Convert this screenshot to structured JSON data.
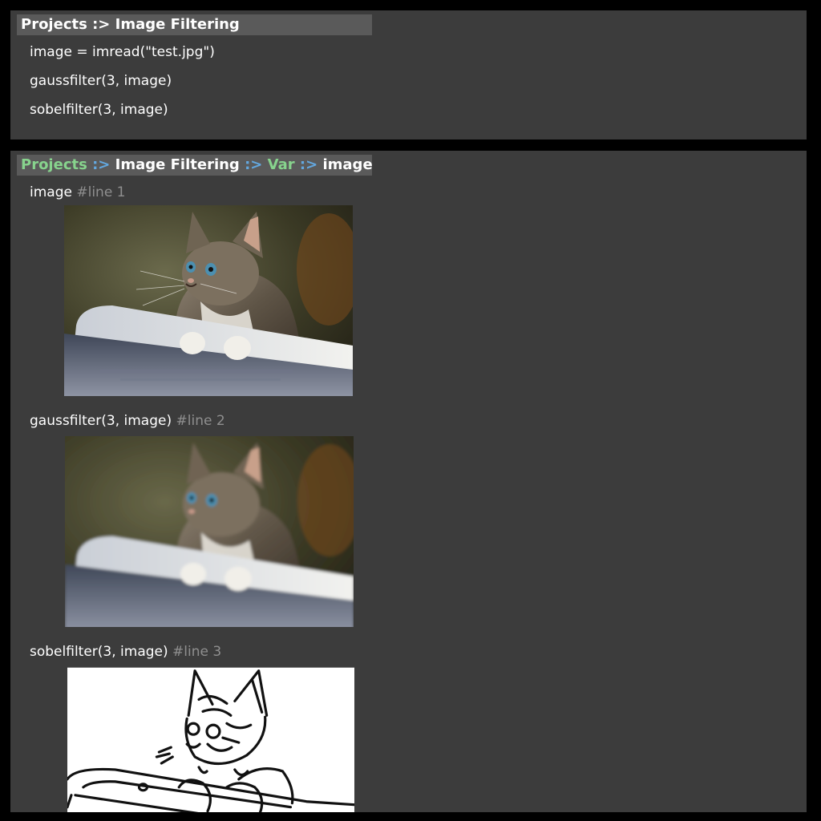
{
  "editor": {
    "breadcrumb": [
      "Projects",
      ":>",
      "Image Filtering"
    ],
    "lines": [
      "image = imread(\"test.jpg\")",
      "gaussfilter(3, image)",
      "sobelfilter(3, image)"
    ]
  },
  "viewer": {
    "breadcrumb": {
      "projects": "Projects",
      "sep1": ":>",
      "project": "Image Filtering",
      "sep2": ":>",
      "var": "Var",
      "sep3": ":>",
      "name": "image"
    },
    "entries": [
      {
        "expr": "image",
        "comment": "#line 1",
        "image_kind": "original"
      },
      {
        "expr": "gaussfilter(3, image)",
        "comment": "#line 2",
        "image_kind": "gaussian-blurred"
      },
      {
        "expr": "sobelfilter(3, image)",
        "comment": "#line 3",
        "image_kind": "sobel-edges"
      }
    ]
  },
  "colors": {
    "background": "#000000",
    "panel": "#3c3c3c",
    "titlebar": "#5a5a5a",
    "breadcrumb_green": "#87d38d",
    "breadcrumb_blue": "#63a8e0",
    "comment": "#8f8f8f"
  }
}
